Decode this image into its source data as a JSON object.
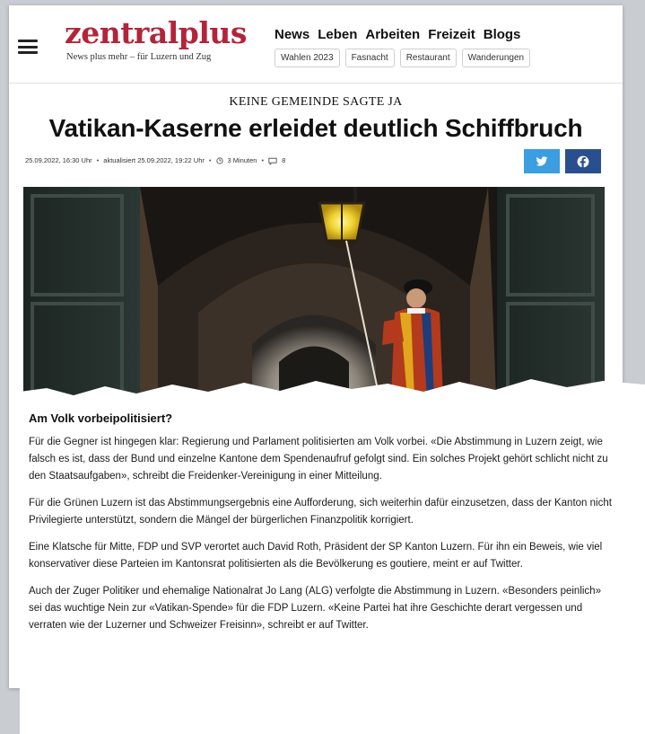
{
  "header": {
    "logo": "zentralplus",
    "tagline": "News plus mehr – für Luzern und Zug",
    "nav": [
      "News",
      "Leben",
      "Arbeiten",
      "Freizeit",
      "Blogs"
    ],
    "tags": [
      "Wahlen 2023",
      "Fasnacht",
      "Restaurant",
      "Wanderungen"
    ]
  },
  "article": {
    "kicker": "KEINE GEMEINDE SAGTE JA",
    "title": "Vatikan-Kaserne erleidet deutlich Schiffbruch",
    "meta": {
      "published": "25.09.2022, 16:30 Uhr",
      "updated": "aktualisiert 25.09.2022, 19:22 Uhr",
      "reading_time": "3 Minuten",
      "comments": "8"
    },
    "share": [
      "twitter-icon",
      "facebook-icon"
    ],
    "subheading": "Am Volk vorbeipolitisiert?",
    "paragraphs": [
      "Für die Gegner ist hingegen klar: Regierung und Parlament politisierten am Volk vorbei. «Die Abstimmung in Luzern zeigt, wie falsch es ist, dass der Bund und einzelne Kantone dem Spendenaufruf gefolgt sind. Ein solches Projekt gehört schlicht nicht zu den Staatsaufgaben», schreibt die Freidenker-Vereinigung in einer Mitteilung.",
      "Für die Grünen Luzern ist das Abstimmungsergebnis eine Aufforderung, sich weiterhin dafür einzusetzen, dass der Kanton nicht Privilegierte unterstützt, sondern die Mängel der bürgerlichen Finanzpolitik korrigiert.",
      "Eine Klatsche für Mitte, FDP und SVP verortet auch David Roth, Präsident der SP Kanton Luzern. Für ihn ein Beweis, wie viel konservativer diese Parteien im Kantonsrat politisierten als die Bevölkerung es goutiere, meint er auf Twitter.",
      "Auch der Zuger Politiker und ehemalige Nationalrat Jo Lang (ALG) verfolgte die Abstimmung in Luzern. «Besonders peinlich» sei das wuchtige Nein zur «Vatikan-Spende» für die FDP Luzern. «Keine Partei hat ihre Geschichte derart vergessen und verraten wie der Luzerner und Schweizer Freisinn», schreibt er auf Twitter."
    ]
  },
  "colors": {
    "brand": "#b3243a",
    "twitter": "#3a9ee0",
    "facebook": "#2a4f8e",
    "background": "#c9ccd1"
  }
}
